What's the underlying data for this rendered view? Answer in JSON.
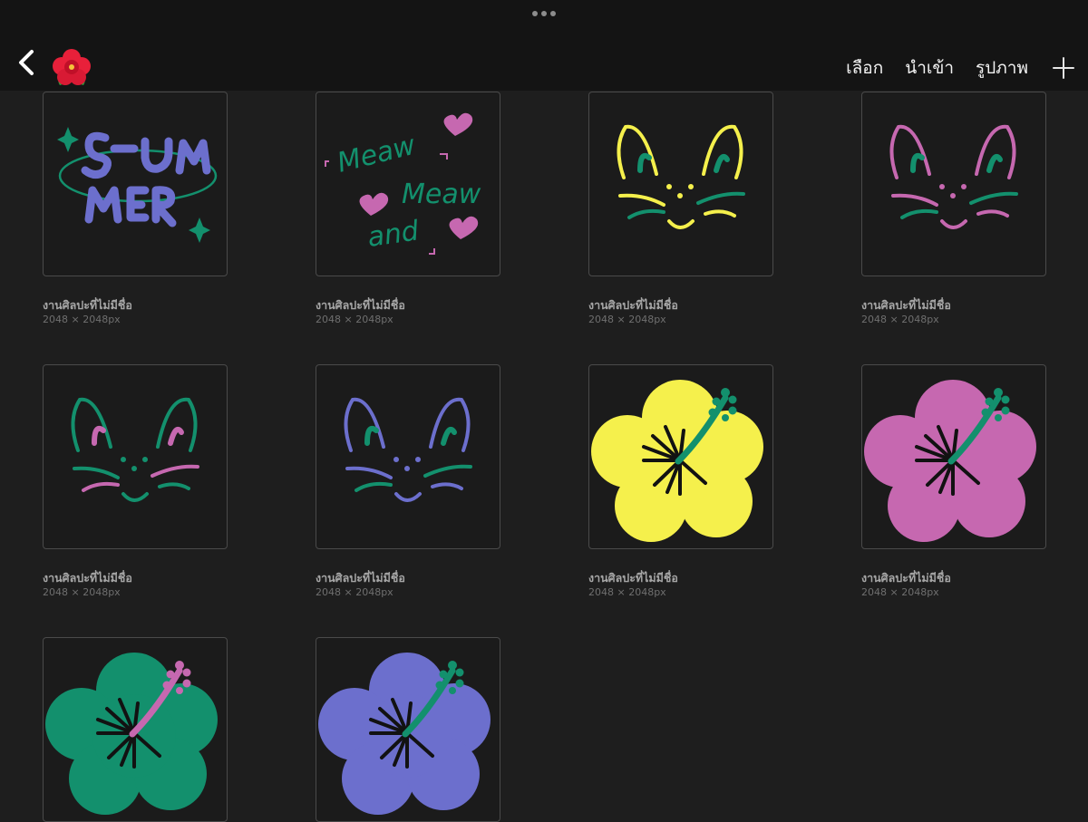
{
  "header": {
    "gallery_icon": "hibiscus-emoji",
    "actions": {
      "select": "เลือก",
      "import": "นำเข้า",
      "photo": "รูปภาพ"
    }
  },
  "colors": {
    "background": "#1e1e1e",
    "topbar": "#141414",
    "yellow": "#f5f04c",
    "pink": "#c668b0",
    "green": "#13906d",
    "violet": "#6c6fcd"
  },
  "artworks": [
    {
      "title": "งานศิลปะที่ไม่มีชื่อ",
      "size": "2048 × 2048px",
      "art": "summer-lettering"
    },
    {
      "title": "งานศิลปะที่ไม่มีชื่อ",
      "size": "2048 × 2048px",
      "art": "meaw-and-meaw-lettering",
      "text": {
        "line1": "Meaw",
        "line2": "Meaw",
        "line3": "and"
      }
    },
    {
      "title": "งานศิลปะที่ไม่มีชื่อ",
      "size": "2048 × 2048px",
      "art": "cat-face-yellow"
    },
    {
      "title": "งานศิลปะที่ไม่มีชื่อ",
      "size": "2048 × 2048px",
      "art": "cat-face-pink"
    },
    {
      "title": "งานศิลปะที่ไม่มีชื่อ",
      "size": "2048 × 2048px",
      "art": "cat-face-green"
    },
    {
      "title": "งานศิลปะที่ไม่มีชื่อ",
      "size": "2048 × 2048px",
      "art": "cat-face-violet"
    },
    {
      "title": "งานศิลปะที่ไม่มีชื่อ",
      "size": "2048 × 2048px",
      "art": "hibiscus-yellow"
    },
    {
      "title": "งานศิลปะที่ไม่มีชื่อ",
      "size": "2048 × 2048px",
      "art": "hibiscus-pink"
    },
    {
      "title": "",
      "size": "",
      "art": "hibiscus-green"
    },
    {
      "title": "",
      "size": "",
      "art": "hibiscus-violet"
    }
  ]
}
